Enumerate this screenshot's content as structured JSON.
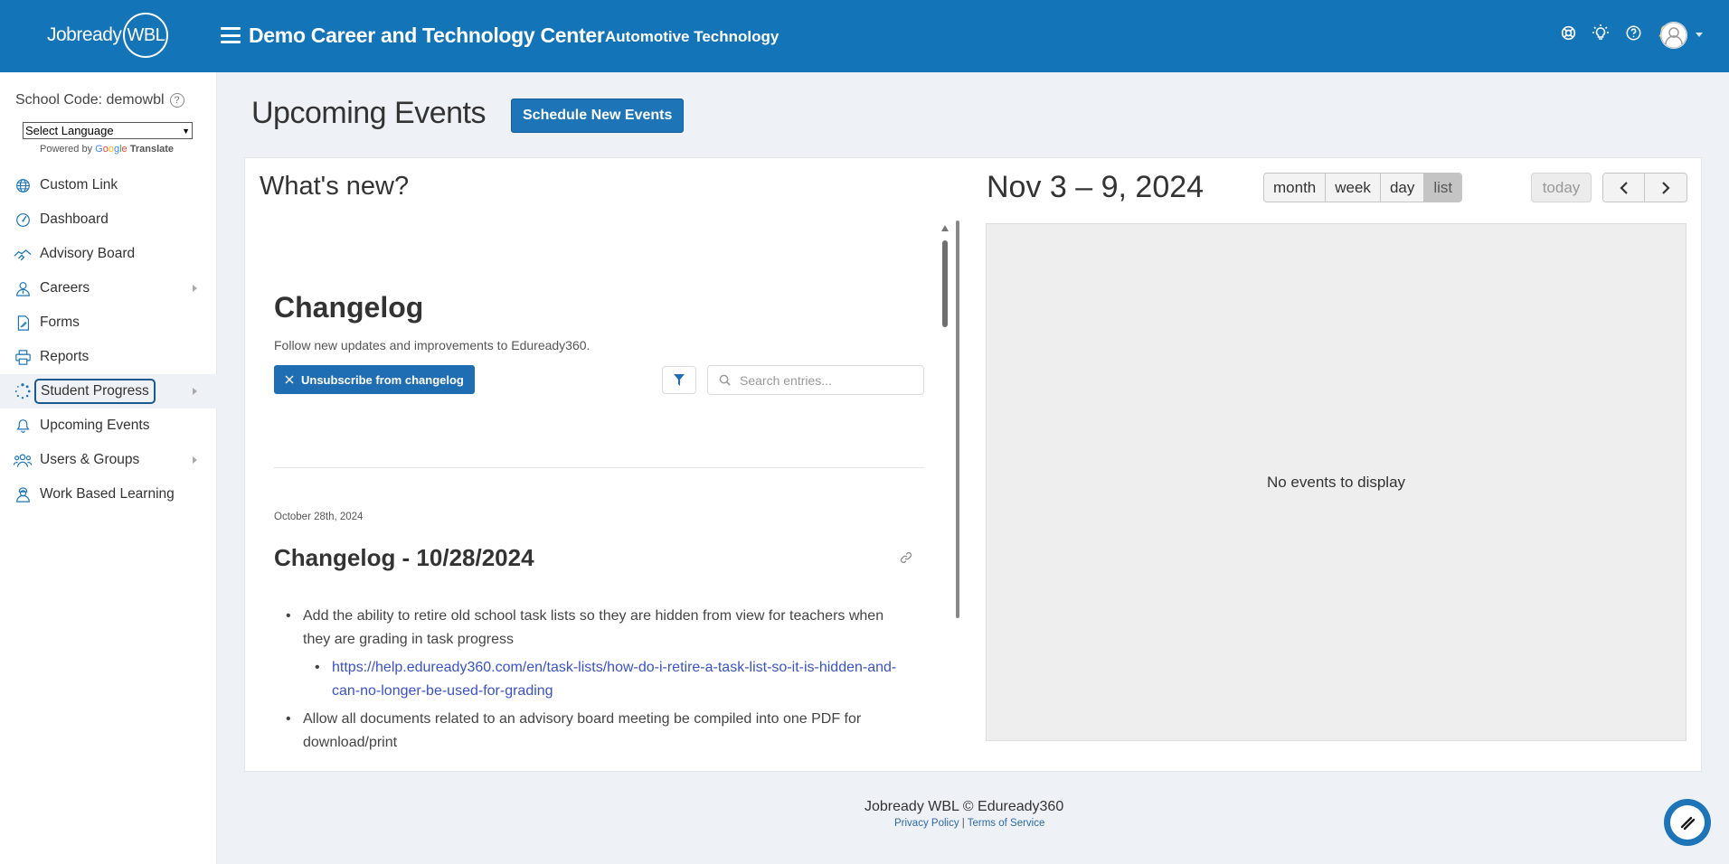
{
  "brand": {
    "logo_text": "Jobready",
    "logo_badge": "WBL"
  },
  "header": {
    "org_title": "Demo Career and Technology Center",
    "program_title": "Automotive Technology",
    "icons": [
      "support-icon",
      "lightbulb-icon",
      "help-icon",
      "bell-icon",
      "avatar"
    ]
  },
  "sidebar": {
    "school_code": "School Code: demowbl",
    "language_select": "Select Language",
    "powered_by": "Powered by",
    "google": "Google",
    "translate": "Translate",
    "items": [
      {
        "label": "Custom Link",
        "icon": "globe-icon",
        "has_children": false
      },
      {
        "label": "Dashboard",
        "icon": "gauge-icon",
        "has_children": false
      },
      {
        "label": "Advisory Board",
        "icon": "handshake-icon",
        "has_children": false
      },
      {
        "label": "Careers",
        "icon": "person-tie-icon",
        "has_children": true
      },
      {
        "label": "Forms",
        "icon": "form-icon",
        "has_children": false
      },
      {
        "label": "Reports",
        "icon": "printer-icon",
        "has_children": false
      },
      {
        "label": "Student Progress",
        "icon": "spinner-icon",
        "has_children": true,
        "active": true
      },
      {
        "label": "Upcoming Events",
        "icon": "bell-icon",
        "has_children": false
      },
      {
        "label": "Users & Groups",
        "icon": "users-icon",
        "has_children": true
      },
      {
        "label": "Work Based Learning",
        "icon": "worker-icon",
        "has_children": false
      }
    ]
  },
  "main": {
    "page_title": "Upcoming Events",
    "schedule_button": "Schedule New Events",
    "whats_new": "What's new?"
  },
  "changelog": {
    "title": "Changelog",
    "subtitle": "Follow new updates and improvements to Eduready360.",
    "unsubscribe": "Unsubscribe from changelog",
    "search_placeholder": "Search entries...",
    "entry_date": "October 28th, 2024",
    "entry_title": "Changelog - 10/28/2024",
    "bullet1": "Add the ability to retire old school task lists so they are hidden from view for teachers when they are grading in task progress",
    "link1": "https://help.eduready360.com/en/task-lists/how-do-i-retire-a-task-list-so-it-is-hidden-and-can-no-longer-be-used-for-grading",
    "bullet2": "Allow all documents related to an advisory board meeting be compiled into one PDF for download/print"
  },
  "calendar": {
    "title": "Nov 3 – 9, 2024",
    "views": [
      "month",
      "week",
      "day",
      "list"
    ],
    "active_view": "list",
    "today": "today",
    "empty": "No events to display"
  },
  "footer": {
    "copyright": "Jobready WBL © Eduready360",
    "privacy": "Privacy Policy",
    "separator": " | ",
    "terms": "Terms of Service"
  },
  "colors": {
    "header": "#1374b8",
    "primary_button": "#1d75b8",
    "link": "#3a52c4",
    "bell": "#f5c542"
  }
}
